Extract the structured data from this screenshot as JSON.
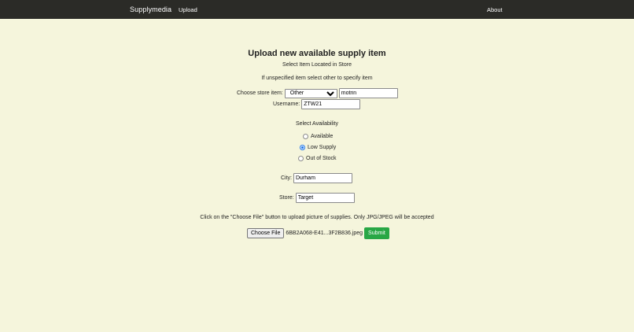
{
  "nav": {
    "brand": "Supplymedia",
    "upload": "Upload",
    "about": "About"
  },
  "form": {
    "title": "Upload new available supply item",
    "subtitle": "Select Item Located in Store",
    "hint": "If unspecified item select other to specify item",
    "store_item_label": "Choose store item:",
    "store_item_selected": "Other",
    "other_item_value": "motrin",
    "username_label": "Username:",
    "username_value": "ZTW21",
    "availability_title": "Select Availability",
    "availability_options": [
      {
        "label": "Available",
        "checked": false
      },
      {
        "label": "Low Supply",
        "checked": true
      },
      {
        "label": "Out of Stock",
        "checked": false
      }
    ],
    "city_label": "City:",
    "city_value": "Durham",
    "store_label": "Store:",
    "store_value": "Target",
    "upload_instructions": "Click on the \"Choose File\" button to upload picture of supplies. Only JPG/JPEG will be accepted",
    "choose_file_label": "Choose File",
    "file_name": "6BB2A068-E41...3F2B836.jpeg",
    "submit_label": "Submit"
  },
  "colors": {
    "background": "#f5f5dc",
    "navbar": "#2b2b27",
    "submit": "#28a745",
    "radio_accent": "#1a73e8"
  }
}
